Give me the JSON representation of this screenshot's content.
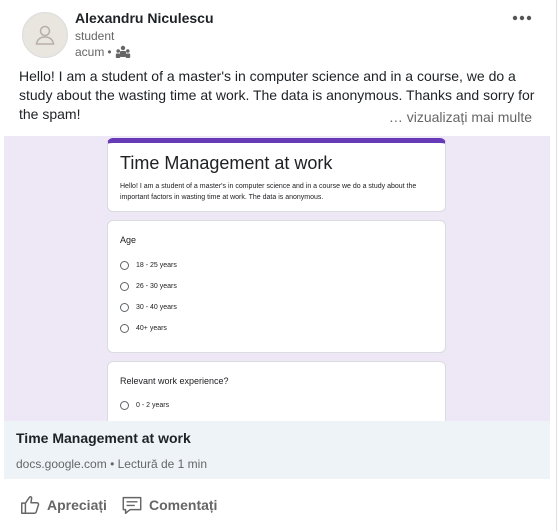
{
  "post": {
    "author_name": "Alexandru Niculescu",
    "author_headline": "student",
    "time": "acum",
    "separator": "•",
    "text": "Hello! I am a student of a master's in computer science and in a course, we do a study about the wasting time at work. The data is anonymous. Thanks and sorry for the spam!",
    "see_more": "… vizualizați mai multe"
  },
  "preview": {
    "form_title": "Time Management at work",
    "form_description": "Hello! I am a student of a master's in computer science and in a course we do a study about the important factors in wasting time at work. The data is anonymous.",
    "question1": {
      "label": "Age",
      "options": [
        "18 - 25 years",
        "26 - 30 years",
        "30 - 40 years",
        "40+ years"
      ]
    },
    "question2": {
      "label": "Relevant work experience?",
      "options": [
        "0 - 2 years"
      ]
    },
    "accent_color": "#673ab7"
  },
  "link": {
    "title": "Time Management at work",
    "domain": "docs.google.com",
    "separator": "•",
    "read_time": "Lectură de 1 min"
  },
  "actions": {
    "like_label": "Apreciați",
    "comment_label": "Comentați"
  }
}
